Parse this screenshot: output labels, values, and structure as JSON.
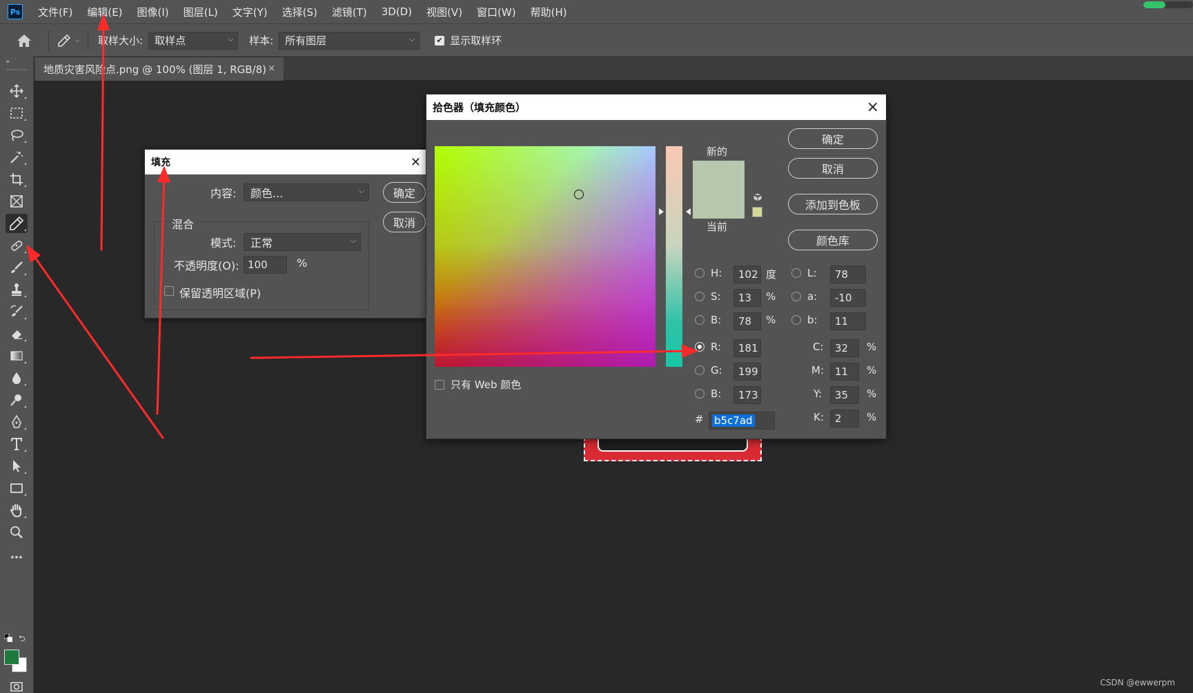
{
  "app": {
    "logo": "Ps"
  },
  "menubar": {
    "items": [
      "文件(F)",
      "编辑(E)",
      "图像(I)",
      "图层(L)",
      "文字(Y)",
      "选择(S)",
      "滤镜(T)",
      "3D(D)",
      "视图(V)",
      "窗口(W)",
      "帮助(H)"
    ],
    "progress_fraction": 0.45
  },
  "options": {
    "sample_size_label": "取样大小:",
    "sample_size_value": "取样点",
    "sample_label": "样本:",
    "sample_value": "所有图层",
    "show_ring_label": "显示取样环",
    "show_ring_checked": true
  },
  "document_tab": {
    "title": "地质灾害风险点.png @ 100% (图层 1, RGB/8)",
    "close": "×"
  },
  "toolbar": {
    "foreground_color": "#1e7a3c",
    "background_color": "#ffffff",
    "tools": [
      "move-icon",
      "marquee-icon",
      "lasso-icon",
      "magic-wand-icon",
      "crop-icon",
      "frame-icon",
      "eyedropper-icon",
      "healing-brush-icon",
      "brush-icon",
      "clone-stamp-icon",
      "history-brush-icon",
      "eraser-icon",
      "gradient-icon",
      "blur-icon",
      "dodge-icon",
      "pen-icon",
      "type-icon",
      "path-selection-icon",
      "rectangle-icon",
      "hand-icon",
      "zoom-icon",
      "more-tools-icon",
      "quick-mask-icon",
      "screen-mode-icon"
    ]
  },
  "fill_dialog": {
    "title": "填充",
    "content_label": "内容:",
    "content_value": "颜色...",
    "ok": "确定",
    "cancel": "取消",
    "blend_legend": "混合",
    "mode_label": "模式:",
    "mode_value": "正常",
    "opacity_label": "不透明度(O):",
    "opacity_value": "100",
    "opacity_unit": "%",
    "preserve_label": "保留透明区域(P)"
  },
  "color_picker": {
    "title": "拾色器（填充颜色）",
    "new_label": "新的",
    "current_label": "当前",
    "new_color": "#b5c7ad",
    "current_color": "#b5c7ad",
    "web_swatch_color": "#d6d89a",
    "buttons": {
      "ok": "确定",
      "cancel": "取消",
      "add_to_swatches": "添加到色板",
      "color_libraries": "颜色库"
    },
    "web_only_label": "只有 Web 颜色",
    "hsb": [
      {
        "label": "H:",
        "value": "102",
        "unit": "度"
      },
      {
        "label": "S:",
        "value": "13",
        "unit": "%"
      },
      {
        "label": "B:",
        "value": "78",
        "unit": "%"
      }
    ],
    "rgb": [
      {
        "label": "R:",
        "value": "181"
      },
      {
        "label": "G:",
        "value": "199"
      },
      {
        "label": "B:",
        "value": "173"
      }
    ],
    "lab": [
      {
        "label": "L:",
        "value": "78"
      },
      {
        "label": "a:",
        "value": "-10"
      },
      {
        "label": "b:",
        "value": "11"
      }
    ],
    "cmyk": [
      {
        "label": "C:",
        "value": "32",
        "unit": "%"
      },
      {
        "label": "M:",
        "value": "11",
        "unit": "%"
      },
      {
        "label": "Y:",
        "value": "35",
        "unit": "%"
      },
      {
        "label": "K:",
        "value": "2",
        "unit": "%"
      }
    ],
    "hex_label": "#",
    "hex_value": "b5c7ad"
  },
  "watermark": "CSDN @ewwerpm"
}
